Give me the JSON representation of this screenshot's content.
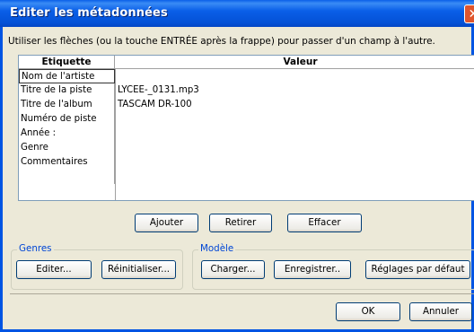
{
  "window": {
    "title": "Editer les métadonnées",
    "close_glyph": "✕"
  },
  "instruction": "Utiliser les flèches (ou la touche ENTRÉE après la frappe) pour passer d'un champ à l'autre.",
  "table": {
    "headers": [
      "Etiquette",
      "Valeur"
    ],
    "rows": [
      {
        "label": "Nom de l'artiste",
        "value": ""
      },
      {
        "label": "Titre de la piste",
        "value": "LYCEE-_0131.mp3"
      },
      {
        "label": "Titre de l'album",
        "value": "TASCAM DR-100"
      },
      {
        "label": "Numéro de piste",
        "value": ""
      },
      {
        "label": "Année :",
        "value": ""
      },
      {
        "label": "Genre",
        "value": ""
      },
      {
        "label": "Commentaires",
        "value": ""
      },
      {
        "label": "",
        "value": ""
      }
    ]
  },
  "row_buttons": {
    "add": "Ajouter",
    "remove": "Retirer",
    "clear": "Effacer"
  },
  "genres": {
    "legend": "Genres",
    "edit": "Editer...",
    "reset": "Réinitialiser..."
  },
  "model": {
    "legend": "Modèle",
    "load": "Charger...",
    "save": "Enregistrer..",
    "defaults": "Réglages par défaut"
  },
  "dialog": {
    "ok": "OK",
    "cancel": "Annuler"
  },
  "colors": {
    "title_bar": "#0a5fe8",
    "legend_text": "#0046d5",
    "dialog_face": "#ece9d8",
    "close_button": "#e0552c"
  }
}
